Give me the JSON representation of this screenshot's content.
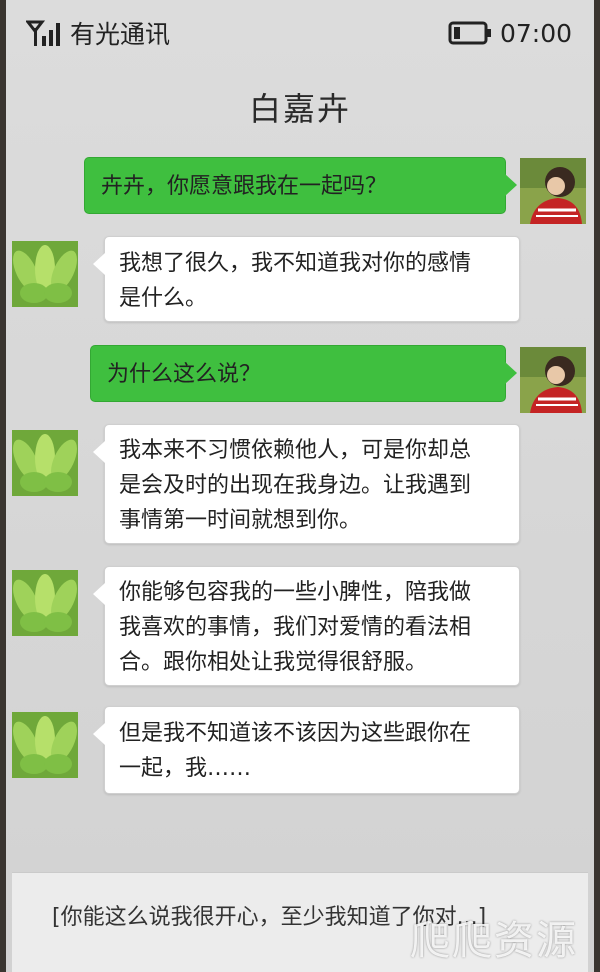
{
  "status_bar": {
    "carrier": "有光通讯",
    "time": "07:00",
    "signal_icon": "signal-icon",
    "battery_icon": "battery-icon"
  },
  "chat": {
    "title": "白嘉卉",
    "messages": [
      {
        "sender": "me",
        "text": "卉卉，你愿意跟我在一起吗？"
      },
      {
        "sender": "them",
        "text": "我想了很久，我不知道我对你的感情\n是什么。"
      },
      {
        "sender": "me",
        "text": "为什么这么说？"
      },
      {
        "sender": "them",
        "text": "我本来不习惯依赖他人，可是你却总\n是会及时的出现在我身边。让我遇到\n事情第一时间就想到你。"
      },
      {
        "sender": "them",
        "text": "你能够包容我的一些小脾性，陪我做\n我喜欢的事情，我们对爱情的看法相\n合。跟你相处让我觉得很舒服。"
      },
      {
        "sender": "them",
        "text": "但是我不知道该不该因为这些跟你在\n一起，我……"
      }
    ]
  },
  "reply": {
    "text": "[你能这么说我很开心，至少我知道了你对...]"
  },
  "watermark": "爬爬资源",
  "colors": {
    "my_bubble": "#3fbf3f",
    "their_bubble": "#ffffff",
    "background": "#d8d8d8"
  }
}
